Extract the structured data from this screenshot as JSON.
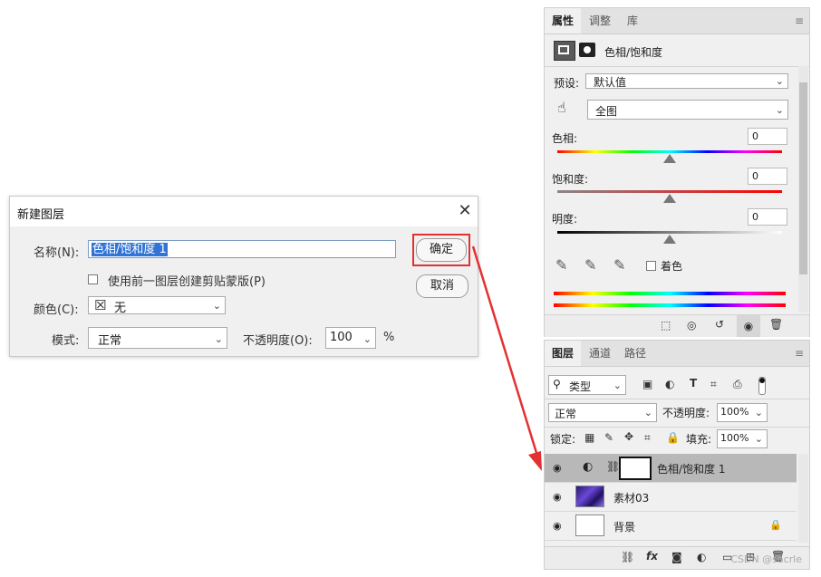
{
  "dialog": {
    "title": "新建图层",
    "close": "✕",
    "name_label": "名称(N):",
    "name_value": "色相/饱和度 1",
    "clip_label": "使用前一图层创建剪贴蒙版(P)",
    "color_label": "颜色(C):",
    "color_value": "无",
    "color_swatch": "☒",
    "mode_label": "模式:",
    "mode_value": "正常",
    "opacity_label": "不透明度(O):",
    "opacity_value": "100",
    "opacity_unit": "%",
    "ok_button": "确定",
    "cancel_button": "取消",
    "highlight_color": "#e33131"
  },
  "properties": {
    "tabs": [
      "属性",
      "调整",
      "库"
    ],
    "title": "色相/饱和度",
    "preset_label": "预设:",
    "preset_value": "默认值",
    "range_value": "全图",
    "hue_label": "色相:",
    "hue_value": "0",
    "saturation_label": "饱和度:",
    "saturation_value": "0",
    "lightness_label": "明度:",
    "lightness_value": "0",
    "colorize_label": "着色"
  },
  "layers": {
    "tabs": [
      "图层",
      "通道",
      "路径"
    ],
    "filter_value": "类型",
    "blend_mode": "正常",
    "opacity_label": "不透明度:",
    "opacity_value": "100%",
    "lock_label": "锁定:",
    "fill_label": "填充:",
    "fill_value": "100%",
    "items": [
      {
        "name": "色相/饱和度 1",
        "selected": true
      },
      {
        "name": "素材03",
        "selected": false
      },
      {
        "name": "背景",
        "selected": false
      }
    ],
    "watermark": "CSDN @sacrle"
  }
}
